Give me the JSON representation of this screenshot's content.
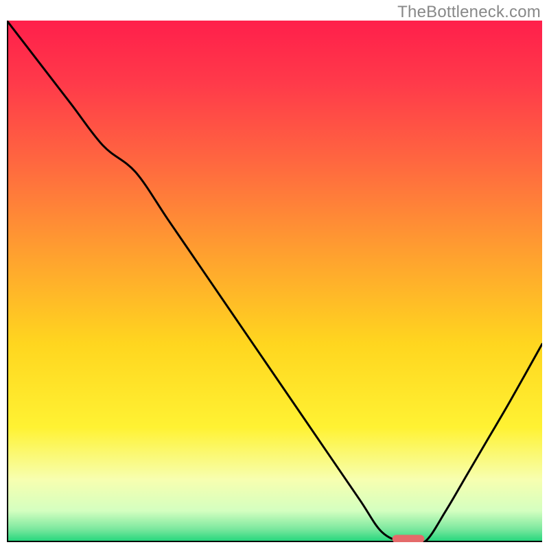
{
  "watermark": "TheBottleneck.com",
  "chart_data": {
    "type": "line",
    "title": "",
    "xlabel": "",
    "ylabel": "",
    "xlim": [
      0,
      100
    ],
    "ylim": [
      0,
      100
    ],
    "note": "Axes unlabeled; rainbow gradient background from red (top) through orange/yellow to green (bottom). Black curve descends steeply from top-left, reaches minimum (~0) around x≈72–78, then rises toward right edge. Small red/pink pill marker at the curve's minimum near y≈0.",
    "series": [
      {
        "name": "curve",
        "x": [
          0,
          6,
          12,
          18,
          24,
          30,
          36,
          42,
          48,
          54,
          60,
          66,
          70,
          74,
          78,
          82,
          86,
          90,
          94,
          100
        ],
        "y": [
          100,
          92,
          84,
          76,
          71,
          62,
          53,
          44,
          35,
          26,
          17,
          8,
          2,
          0,
          0,
          6,
          13,
          20,
          27,
          38
        ]
      }
    ],
    "marker": {
      "x_start": 72,
      "x_end": 78,
      "y": 0.6,
      "color": "#e46a6a"
    },
    "gradient_stops": [
      {
        "offset": 0.0,
        "color": "#ff1f4b"
      },
      {
        "offset": 0.12,
        "color": "#ff3a4a"
      },
      {
        "offset": 0.28,
        "color": "#ff6a3f"
      },
      {
        "offset": 0.45,
        "color": "#ffa12f"
      },
      {
        "offset": 0.62,
        "color": "#ffd61f"
      },
      {
        "offset": 0.78,
        "color": "#fff233"
      },
      {
        "offset": 0.88,
        "color": "#f7ffb0"
      },
      {
        "offset": 0.94,
        "color": "#d4ffc0"
      },
      {
        "offset": 0.975,
        "color": "#7be89e"
      },
      {
        "offset": 1.0,
        "color": "#1ed57a"
      }
    ]
  }
}
